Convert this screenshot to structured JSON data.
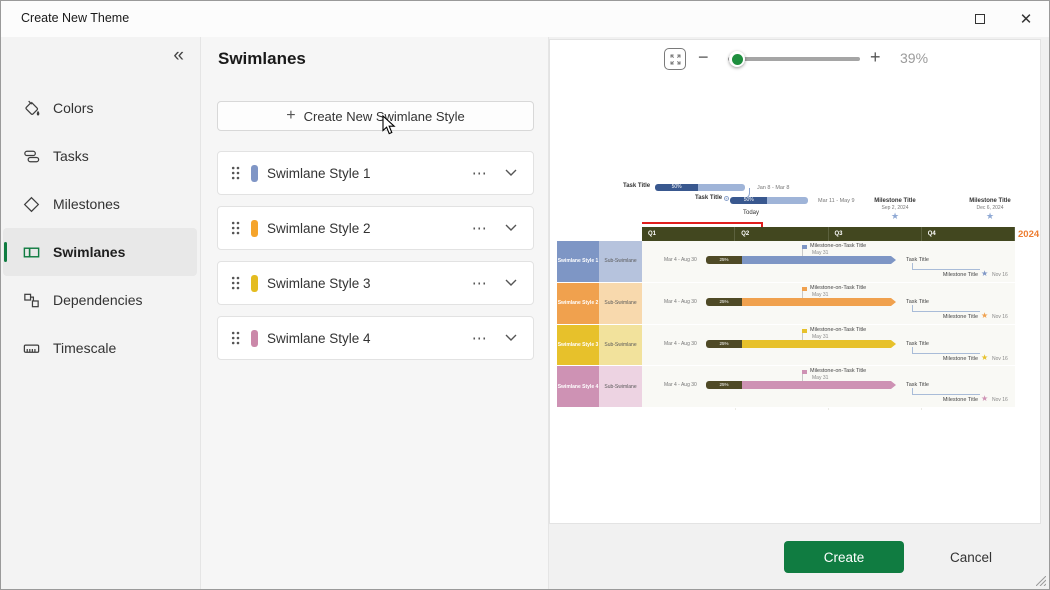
{
  "window": {
    "title": "Create New Theme",
    "controls": {
      "maximize": "maximize",
      "close": "✕"
    }
  },
  "sidebar": {
    "collapse_icon": "«",
    "items": [
      {
        "label": "Colors",
        "icon": "paint-bucket-icon",
        "selected": false
      },
      {
        "label": "Tasks",
        "icon": "task-bars-icon",
        "selected": false
      },
      {
        "label": "Milestones",
        "icon": "diamond-icon",
        "selected": false
      },
      {
        "label": "Swimlanes",
        "icon": "swimlane-icon",
        "selected": true
      },
      {
        "label": "Dependencies",
        "icon": "dependency-icon",
        "selected": false
      },
      {
        "label": "Timescale",
        "icon": "ruler-icon",
        "selected": false
      }
    ]
  },
  "panel": {
    "title": "Swimlanes",
    "create_button": {
      "plus": "+",
      "label": "Create New Swimlane Style"
    },
    "more_icon": "⋯",
    "items": [
      {
        "label": "Swimlane Style 1",
        "color": "#8096C6"
      },
      {
        "label": "Swimlane Style 2",
        "color": "#F5A42B"
      },
      {
        "label": "Swimlane Style 3",
        "color": "#E4BC20"
      },
      {
        "label": "Swimlane Style 4",
        "color": "#CB88A9"
      }
    ]
  },
  "preview": {
    "zoom": {
      "fit_icon": "fit-to-screen",
      "minus": "−",
      "plus": "+",
      "value": "39%",
      "slider_percent": 7,
      "thumb_color": "#1E8E3E"
    }
  },
  "chart_data": {
    "type": "gantt-preview",
    "year": "2024",
    "quarters": [
      "Q1",
      "Q2",
      "Q3",
      "Q4"
    ],
    "today_label": "Today",
    "timeline_band_color": "#42471F",
    "today_line_color": "#E01E1E",
    "year_color": "#ED7D31",
    "top_tasks": [
      {
        "label": "Task Title",
        "percent": "50%",
        "dates": "Jan 8 - Mar 8"
      },
      {
        "label": "Task Title",
        "percent": "50%",
        "dates": "Mar 11 - May 9"
      }
    ],
    "top_milestones": [
      {
        "label": "Milestone Title",
        "date": "Sep 2, 2024"
      },
      {
        "label": "Milestone Title",
        "date": "Dec 6, 2024"
      }
    ],
    "swimlanes": [
      {
        "name": "Swimlane Style 1",
        "sub": "Sub-Swimlane",
        "dates": "Mar 4 - Aug 30",
        "percent": "25%",
        "milestone_on_task": {
          "label": "Milestone-on-Task Title",
          "date": "May 31"
        },
        "task_label": "Task Title",
        "milestone": {
          "label": "Milestone Title",
          "date": "Nov 16"
        },
        "colors": {
          "main": "#7E96C5",
          "sub": "#B6C3DD"
        }
      },
      {
        "name": "Swimlane Style 2",
        "sub": "Sub-Swimlane",
        "dates": "Mar 4 - Aug 30",
        "percent": "25%",
        "milestone_on_task": {
          "label": "Milestone-on-Task Title",
          "date": "May 31"
        },
        "task_label": "Task Title",
        "milestone": {
          "label": "Milestone Title",
          "date": "Nov 16"
        },
        "colors": {
          "main": "#F0A14E",
          "sub": "#F8D9AD"
        }
      },
      {
        "name": "Swimlane Style 3",
        "sub": "Sub-Swimlane",
        "dates": "Mar 4 - Aug 30",
        "percent": "25%",
        "milestone_on_task": {
          "label": "Milestone-on-Task Title",
          "date": "May 31"
        },
        "task_label": "Task Title",
        "milestone": {
          "label": "Milestone Title",
          "date": "Nov 16"
        },
        "colors": {
          "main": "#E7C12B",
          "sub": "#F2E29C"
        }
      },
      {
        "name": "Swimlane Style 4",
        "sub": "Sub-Swimlane",
        "dates": "Mar 4 - Aug 30",
        "percent": "25%",
        "milestone_on_task": {
          "label": "Milestone-on-Task Title",
          "date": "May 31"
        },
        "task_label": "Task Title",
        "milestone": {
          "label": "Milestone Title",
          "date": "Nov 16"
        },
        "colors": {
          "main": "#CE92B4",
          "sub": "#EDD3E2"
        }
      }
    ]
  },
  "footer": {
    "create_label": "Create",
    "cancel_label": "Cancel"
  },
  "colors": {
    "accent_green": "#107C41"
  }
}
